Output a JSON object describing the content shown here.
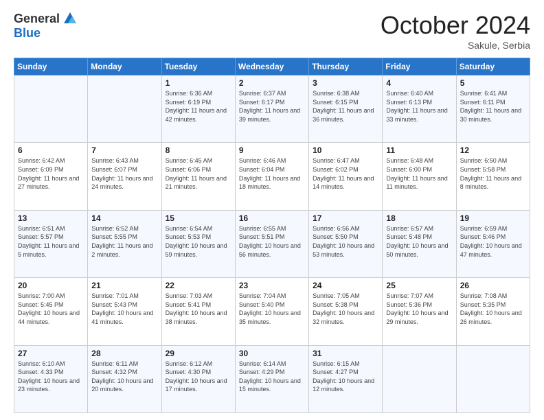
{
  "header": {
    "logo_general": "General",
    "logo_blue": "Blue",
    "month_title": "October 2024",
    "subtitle": "Sakule, Serbia"
  },
  "days_of_week": [
    "Sunday",
    "Monday",
    "Tuesday",
    "Wednesday",
    "Thursday",
    "Friday",
    "Saturday"
  ],
  "weeks": [
    [
      {
        "day": "",
        "info": ""
      },
      {
        "day": "",
        "info": ""
      },
      {
        "day": "1",
        "info": "Sunrise: 6:36 AM\nSunset: 6:19 PM\nDaylight: 11 hours and 42 minutes."
      },
      {
        "day": "2",
        "info": "Sunrise: 6:37 AM\nSunset: 6:17 PM\nDaylight: 11 hours and 39 minutes."
      },
      {
        "day": "3",
        "info": "Sunrise: 6:38 AM\nSunset: 6:15 PM\nDaylight: 11 hours and 36 minutes."
      },
      {
        "day": "4",
        "info": "Sunrise: 6:40 AM\nSunset: 6:13 PM\nDaylight: 11 hours and 33 minutes."
      },
      {
        "day": "5",
        "info": "Sunrise: 6:41 AM\nSunset: 6:11 PM\nDaylight: 11 hours and 30 minutes."
      }
    ],
    [
      {
        "day": "6",
        "info": "Sunrise: 6:42 AM\nSunset: 6:09 PM\nDaylight: 11 hours and 27 minutes."
      },
      {
        "day": "7",
        "info": "Sunrise: 6:43 AM\nSunset: 6:07 PM\nDaylight: 11 hours and 24 minutes."
      },
      {
        "day": "8",
        "info": "Sunrise: 6:45 AM\nSunset: 6:06 PM\nDaylight: 11 hours and 21 minutes."
      },
      {
        "day": "9",
        "info": "Sunrise: 6:46 AM\nSunset: 6:04 PM\nDaylight: 11 hours and 18 minutes."
      },
      {
        "day": "10",
        "info": "Sunrise: 6:47 AM\nSunset: 6:02 PM\nDaylight: 11 hours and 14 minutes."
      },
      {
        "day": "11",
        "info": "Sunrise: 6:48 AM\nSunset: 6:00 PM\nDaylight: 11 hours and 11 minutes."
      },
      {
        "day": "12",
        "info": "Sunrise: 6:50 AM\nSunset: 5:58 PM\nDaylight: 11 hours and 8 minutes."
      }
    ],
    [
      {
        "day": "13",
        "info": "Sunrise: 6:51 AM\nSunset: 5:57 PM\nDaylight: 11 hours and 5 minutes."
      },
      {
        "day": "14",
        "info": "Sunrise: 6:52 AM\nSunset: 5:55 PM\nDaylight: 11 hours and 2 minutes."
      },
      {
        "day": "15",
        "info": "Sunrise: 6:54 AM\nSunset: 5:53 PM\nDaylight: 10 hours and 59 minutes."
      },
      {
        "day": "16",
        "info": "Sunrise: 6:55 AM\nSunset: 5:51 PM\nDaylight: 10 hours and 56 minutes."
      },
      {
        "day": "17",
        "info": "Sunrise: 6:56 AM\nSunset: 5:50 PM\nDaylight: 10 hours and 53 minutes."
      },
      {
        "day": "18",
        "info": "Sunrise: 6:57 AM\nSunset: 5:48 PM\nDaylight: 10 hours and 50 minutes."
      },
      {
        "day": "19",
        "info": "Sunrise: 6:59 AM\nSunset: 5:46 PM\nDaylight: 10 hours and 47 minutes."
      }
    ],
    [
      {
        "day": "20",
        "info": "Sunrise: 7:00 AM\nSunset: 5:45 PM\nDaylight: 10 hours and 44 minutes."
      },
      {
        "day": "21",
        "info": "Sunrise: 7:01 AM\nSunset: 5:43 PM\nDaylight: 10 hours and 41 minutes."
      },
      {
        "day": "22",
        "info": "Sunrise: 7:03 AM\nSunset: 5:41 PM\nDaylight: 10 hours and 38 minutes."
      },
      {
        "day": "23",
        "info": "Sunrise: 7:04 AM\nSunset: 5:40 PM\nDaylight: 10 hours and 35 minutes."
      },
      {
        "day": "24",
        "info": "Sunrise: 7:05 AM\nSunset: 5:38 PM\nDaylight: 10 hours and 32 minutes."
      },
      {
        "day": "25",
        "info": "Sunrise: 7:07 AM\nSunset: 5:36 PM\nDaylight: 10 hours and 29 minutes."
      },
      {
        "day": "26",
        "info": "Sunrise: 7:08 AM\nSunset: 5:35 PM\nDaylight: 10 hours and 26 minutes."
      }
    ],
    [
      {
        "day": "27",
        "info": "Sunrise: 6:10 AM\nSunset: 4:33 PM\nDaylight: 10 hours and 23 minutes."
      },
      {
        "day": "28",
        "info": "Sunrise: 6:11 AM\nSunset: 4:32 PM\nDaylight: 10 hours and 20 minutes."
      },
      {
        "day": "29",
        "info": "Sunrise: 6:12 AM\nSunset: 4:30 PM\nDaylight: 10 hours and 17 minutes."
      },
      {
        "day": "30",
        "info": "Sunrise: 6:14 AM\nSunset: 4:29 PM\nDaylight: 10 hours and 15 minutes."
      },
      {
        "day": "31",
        "info": "Sunrise: 6:15 AM\nSunset: 4:27 PM\nDaylight: 10 hours and 12 minutes."
      },
      {
        "day": "",
        "info": ""
      },
      {
        "day": "",
        "info": ""
      }
    ]
  ]
}
